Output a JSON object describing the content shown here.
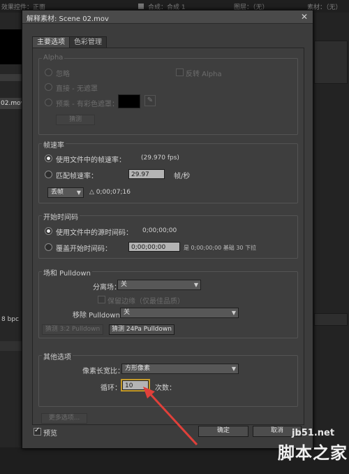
{
  "background": {
    "panel_title": "效果控件：正面",
    "comp_label": "合成：合成 1",
    "layer_label": "图层：（无）",
    "footage_label": "素材：（无）",
    "file_tab": "02.mov",
    "bpc": "8 bpc"
  },
  "dialog": {
    "title": "解释素材: Scene 02.mov",
    "close_symbol": "✕",
    "tabs": [
      {
        "label": "主要选项",
        "active": true
      },
      {
        "label": "色彩管理",
        "active": false
      }
    ],
    "alpha": {
      "title": "Alpha",
      "ignore": "忽略",
      "invert": "反转 Alpha",
      "straight": "直接 - 无遮罩",
      "premultiplied": "预乘 - 有彩色遮罩：",
      "guess": "猜测",
      "matte_color": "#000000"
    },
    "frame_rate": {
      "title": "帧速率",
      "use_file": "使用文件中的帧速率：",
      "file_fps": "(29.970 fps)",
      "conform": "匹配帧速率：",
      "conform_value": "29.97",
      "unit": "帧/秒",
      "drop_frame": "丢帧",
      "duration": "△ 0;00;07;16"
    },
    "start_timecode": {
      "title": "开始时间码",
      "use_file": "使用文件中的源时间码：",
      "file_value": "0;00;00;00",
      "override": "覆盖开始时间码：",
      "override_value": "0;00;00;00",
      "note": "是 0;00;00;00  基础 30 下拉"
    },
    "fields_pulldown": {
      "title": "场和 Pulldown",
      "separate_fields_label": "分离场：",
      "separate_fields_value": "关",
      "preserve_edges": "保留边缘（仅最佳品质）",
      "remove_pulldown_label": "移除 Pulldown：",
      "remove_pulldown_value": "关",
      "guess_32": "猜测 3:2 Pulldown",
      "guess_24pa": "猜测 24Pa Pulldown"
    },
    "other": {
      "title": "其他选项",
      "par_label": "像素长宽比：",
      "par_value": "方形像素",
      "loop_label": "循环：",
      "loop_value": "10",
      "loop_unit": "次数："
    },
    "more_options": "更多选项...",
    "preview": "预览",
    "ok": "确定",
    "cancel": "取消"
  },
  "watermark": {
    "site": "jb51.net",
    "name": "脚本之家"
  },
  "colors": {
    "annotation_arrow": "#e0403a",
    "focus_ring": "#c49a2a"
  }
}
